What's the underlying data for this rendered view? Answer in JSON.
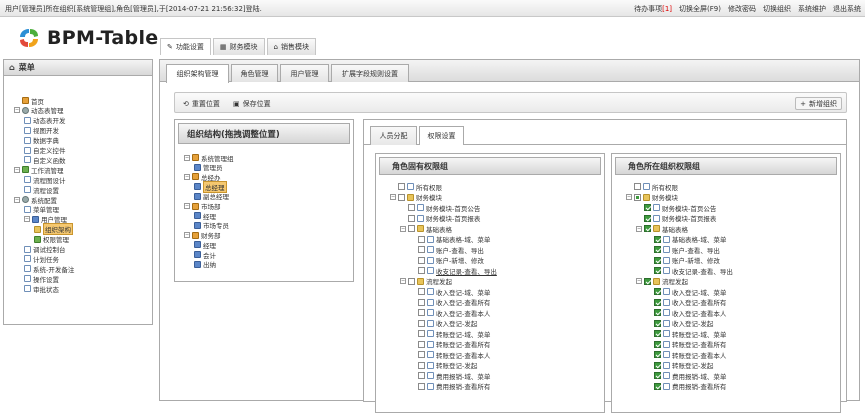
{
  "topbar": {
    "login_info": "用户[管理员]所在组织[系统管理组],角色[管理员],于[2014-07-21 21:56:32]登陆.",
    "todo_label": "待办事项",
    "todo_count": "[1]",
    "links": [
      "切换全屏(F9)",
      "修改密码",
      "切换组织",
      "系统维护",
      "退出系统"
    ]
  },
  "app": {
    "title": "BPM-Table"
  },
  "module_tabs": [
    "功能设置",
    "财务模块",
    "销售模块"
  ],
  "sidebar": {
    "title": "菜单",
    "items": [
      {
        "label": "首页",
        "level": 0,
        "icon": "home-icon"
      },
      {
        "label": "动态表管理",
        "level": 0,
        "toggle": "−",
        "icon": "gear-icon"
      },
      {
        "label": "动态表开发",
        "level": 1,
        "icon": "page-icon"
      },
      {
        "label": "视图开发",
        "level": 1,
        "icon": "grid-icon"
      },
      {
        "label": "数据字典",
        "level": 1,
        "icon": "book-icon"
      },
      {
        "label": "自定义控件",
        "level": 1,
        "icon": "control-icon"
      },
      {
        "label": "自定义函数",
        "level": 1,
        "icon": "function-icon"
      },
      {
        "label": "工作流管理",
        "level": 0,
        "toggle": "−",
        "icon": "workflow-icon"
      },
      {
        "label": "流程图设计",
        "level": 1,
        "icon": "design-icon"
      },
      {
        "label": "流程设置",
        "level": 1,
        "icon": "settings-icon"
      },
      {
        "label": "系统配置",
        "level": 0,
        "toggle": "−",
        "icon": "gear-icon"
      },
      {
        "label": "菜单管理",
        "level": 1,
        "icon": "menu-icon"
      },
      {
        "label": "用户管理",
        "level": 1,
        "toggle": "−",
        "icon": "user-icon"
      },
      {
        "label": "组织架构",
        "level": 2,
        "icon": "org-icon",
        "selected": true
      },
      {
        "label": "权限管理",
        "level": 2,
        "icon": "permission-icon"
      },
      {
        "label": "调试控制台",
        "level": 1,
        "icon": "console-icon"
      },
      {
        "label": "计划任务",
        "level": 1,
        "icon": "task-icon"
      },
      {
        "label": "系统-开发备注",
        "level": 1,
        "icon": "note-icon"
      },
      {
        "label": "操作设置",
        "level": 1,
        "icon": "operation-icon"
      },
      {
        "label": "审批状态",
        "level": 1,
        "icon": "approval-icon"
      }
    ]
  },
  "main_tabs": [
    "组织架构管理",
    "角色管理",
    "用户管理",
    "扩展字段规则设置"
  ],
  "toolbar": {
    "reset": "重置位置",
    "save": "保存位置",
    "add": "新增组织"
  },
  "org_panel": {
    "title": "组织结构(拖拽调整位置)",
    "items": [
      {
        "label": "系统管理组",
        "level": 0,
        "toggle": "−"
      },
      {
        "label": "管理员",
        "level": 1
      },
      {
        "label": "总经办",
        "level": 0,
        "toggle": "−"
      },
      {
        "label": "总经理",
        "level": 1,
        "selected": true
      },
      {
        "label": "副总经理",
        "level": 1
      },
      {
        "label": "市场部",
        "level": 0,
        "toggle": "−"
      },
      {
        "label": "经理",
        "level": 1
      },
      {
        "label": "市场专员",
        "level": 1
      },
      {
        "label": "财务部",
        "level": 0,
        "toggle": "−"
      },
      {
        "label": "经理",
        "level": 1
      },
      {
        "label": "会计",
        "level": 1
      },
      {
        "label": "出纳",
        "level": 1
      }
    ]
  },
  "sub_tabs": [
    "人员分配",
    "权限设置"
  ],
  "role_perm": {
    "title": "角色固有权限组",
    "items": [
      {
        "label": "所有权限",
        "level": 0,
        "state": "none"
      },
      {
        "label": "财务模块",
        "level": 0,
        "state": "none",
        "toggle": "−",
        "folder": true
      },
      {
        "label": "财务模块-首页公告",
        "level": 1,
        "state": "none"
      },
      {
        "label": "财务模块-首页报表",
        "level": 1,
        "state": "none"
      },
      {
        "label": "基础表格",
        "level": 1,
        "state": "none",
        "toggle": "−",
        "folder": true
      },
      {
        "label": "基础表格-域、菜单",
        "level": 2,
        "state": "none"
      },
      {
        "label": "账户-查看、导出",
        "level": 2,
        "state": "none"
      },
      {
        "label": "账户-新增、修改",
        "level": 2,
        "state": "none"
      },
      {
        "label": "收支记录-查看、导出",
        "level": 2,
        "state": "none",
        "underline": true
      },
      {
        "label": "流程发起",
        "level": 1,
        "state": "none",
        "toggle": "−",
        "folder": true
      },
      {
        "label": "收入登记-域、菜单",
        "level": 2,
        "state": "none"
      },
      {
        "label": "收入登记-查看所有",
        "level": 2,
        "state": "none"
      },
      {
        "label": "收入登记-查看本人",
        "level": 2,
        "state": "none"
      },
      {
        "label": "收入登记-发起",
        "level": 2,
        "state": "none"
      },
      {
        "label": "转账登记-域、菜单",
        "level": 2,
        "state": "none"
      },
      {
        "label": "转账登记-查看所有",
        "level": 2,
        "state": "none"
      },
      {
        "label": "转账登记-查看本人",
        "level": 2,
        "state": "none"
      },
      {
        "label": "转账登记-发起",
        "level": 2,
        "state": "none"
      },
      {
        "label": "费用报销-域、菜单",
        "level": 2,
        "state": "none"
      },
      {
        "label": "费用报销-查看所有",
        "level": 2,
        "state": "none"
      }
    ]
  },
  "org_perm": {
    "title": "角色所在组织权限组",
    "items": [
      {
        "label": "所有权限",
        "level": 0,
        "state": "none"
      },
      {
        "label": "财务模块",
        "level": 0,
        "state": "partial",
        "toggle": "−",
        "folder": true
      },
      {
        "label": "财务模块-首页公告",
        "level": 1,
        "state": "checked"
      },
      {
        "label": "财务模块-首页报表",
        "level": 1,
        "state": "checked"
      },
      {
        "label": "基础表格",
        "level": 1,
        "state": "checked",
        "toggle": "−",
        "folder": true
      },
      {
        "label": "基础表格-域、菜单",
        "level": 2,
        "state": "checked"
      },
      {
        "label": "账户-查看、导出",
        "level": 2,
        "state": "checked"
      },
      {
        "label": "账户-新增、修改",
        "level": 2,
        "state": "checked"
      },
      {
        "label": "收支记录-查看、导出",
        "level": 2,
        "state": "checked"
      },
      {
        "label": "流程发起",
        "level": 1,
        "state": "checked",
        "toggle": "−",
        "folder": true
      },
      {
        "label": "收入登记-域、菜单",
        "level": 2,
        "state": "checked"
      },
      {
        "label": "收入登记-查看所有",
        "level": 2,
        "state": "checked"
      },
      {
        "label": "收入登记-查看本人",
        "level": 2,
        "state": "checked"
      },
      {
        "label": "收入登记-发起",
        "level": 2,
        "state": "checked"
      },
      {
        "label": "转账登记-域、菜单",
        "level": 2,
        "state": "checked"
      },
      {
        "label": "转账登记-查看所有",
        "level": 2,
        "state": "checked"
      },
      {
        "label": "转账登记-查看本人",
        "level": 2,
        "state": "checked"
      },
      {
        "label": "转账登记-发起",
        "level": 2,
        "state": "checked"
      },
      {
        "label": "费用报销-域、菜单",
        "level": 2,
        "state": "checked"
      },
      {
        "label": "费用报销-查看所有",
        "level": 2,
        "state": "checked"
      }
    ]
  }
}
